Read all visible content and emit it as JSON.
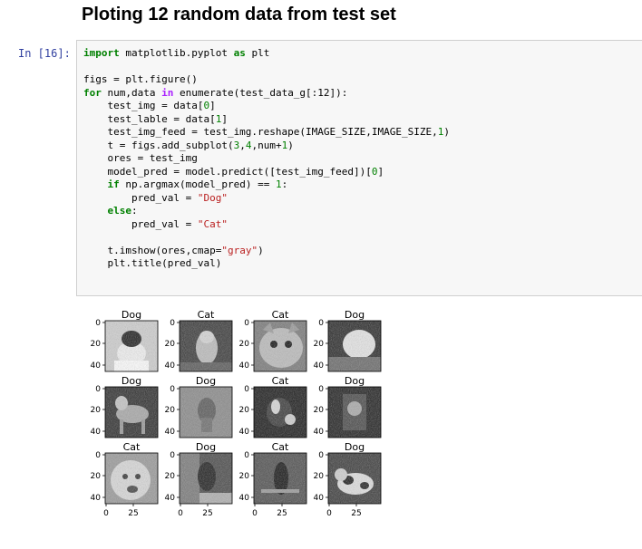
{
  "heading": "Ploting 12 random data from test set",
  "prompt": "In [16]:",
  "code_lines": [
    [
      {
        "t": "import",
        "c": "kw"
      },
      {
        "t": " matplotlib.pyplot "
      },
      {
        "t": "as",
        "c": "kw"
      },
      {
        "t": " plt"
      }
    ],
    [],
    [
      {
        "t": "figs = plt.figure()"
      }
    ],
    [
      {
        "t": "for",
        "c": "kw"
      },
      {
        "t": " num,data "
      },
      {
        "t": "in",
        "c": "op"
      },
      {
        "t": " enumerate(test_data_g[:12]):"
      }
    ],
    [
      {
        "t": "    test_img = data["
      },
      {
        "t": "0",
        "c": "num"
      },
      {
        "t": "]"
      }
    ],
    [
      {
        "t": "    test_lable = data["
      },
      {
        "t": "1",
        "c": "num"
      },
      {
        "t": "]"
      }
    ],
    [
      {
        "t": "    test_img_feed = test_img.reshape(IMAGE_SIZE,IMAGE_SIZE,"
      },
      {
        "t": "1",
        "c": "num"
      },
      {
        "t": ")"
      }
    ],
    [
      {
        "t": "    t = figs.add_subplot("
      },
      {
        "t": "3",
        "c": "num"
      },
      {
        "t": ","
      },
      {
        "t": "4",
        "c": "num"
      },
      {
        "t": ",num+"
      },
      {
        "t": "1",
        "c": "num"
      },
      {
        "t": ")"
      }
    ],
    [
      {
        "t": "    ores = test_img"
      }
    ],
    [
      {
        "t": "    model_pred = model.predict([test_img_feed])["
      },
      {
        "t": "0",
        "c": "num"
      },
      {
        "t": "]"
      }
    ],
    [
      {
        "t": "    "
      },
      {
        "t": "if",
        "c": "kw"
      },
      {
        "t": " np.argmax(model_pred) == "
      },
      {
        "t": "1",
        "c": "num"
      },
      {
        "t": ":"
      }
    ],
    [
      {
        "t": "        pred_val = "
      },
      {
        "t": "\"Dog\"",
        "c": "str"
      }
    ],
    [
      {
        "t": "    "
      },
      {
        "t": "else",
        "c": "kw"
      },
      {
        "t": ":"
      }
    ],
    [
      {
        "t": "        pred_val = "
      },
      {
        "t": "\"Cat\"",
        "c": "str"
      }
    ],
    [],
    [
      {
        "t": "    t.imshow(ores,cmap="
      },
      {
        "t": "\"gray\"",
        "c": "str"
      },
      {
        "t": ")"
      }
    ],
    [
      {
        "t": "    plt.title(pred_val)"
      }
    ]
  ],
  "subplots": [
    {
      "title": "Dog",
      "scene": "dog-snow"
    },
    {
      "title": "Cat",
      "scene": "cat-light"
    },
    {
      "title": "Cat",
      "scene": "cat-face"
    },
    {
      "title": "Dog",
      "scene": "dog-white"
    },
    {
      "title": "Dog",
      "scene": "dog-standing"
    },
    {
      "title": "Dog",
      "scene": "dog-grass"
    },
    {
      "title": "Cat",
      "scene": "cat-dark"
    },
    {
      "title": "Dog",
      "scene": "dog-dark"
    },
    {
      "title": "Cat",
      "scene": "dog-face"
    },
    {
      "title": "Dog",
      "scene": "dog-sitting"
    },
    {
      "title": "Cat",
      "scene": "dog-black"
    },
    {
      "title": "Dog",
      "scene": "dog-spotted"
    }
  ],
  "y_ticks": [
    "0",
    "20",
    "40"
  ],
  "x_ticks": [
    "0",
    "25"
  ],
  "colors": {
    "prompt": "#303f9f",
    "keyword": "#008000",
    "operator": "#aa22ff",
    "string": "#ba2121",
    "cell_bg": "#f7f7f7",
    "cell_border": "#cfcfcf"
  }
}
